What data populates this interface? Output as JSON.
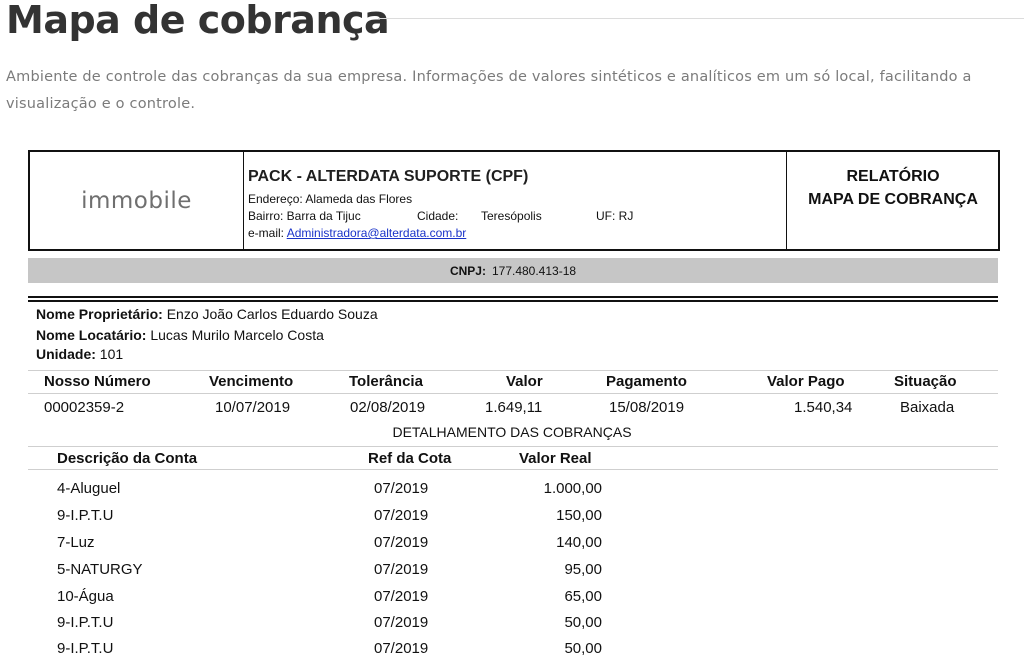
{
  "page": {
    "title": "Mapa de cobrança",
    "description": "Ambiente de controle das cobranças da sua empresa. Informações de valores sintéticos e analíticos em um só local, facilitando a visualização e o controle."
  },
  "report_header": {
    "logo_text": "immobile",
    "company_name": "PACK - ALTERDATA SUPORTE (CPF)",
    "address": "Endereço: Alameda das Flores",
    "bairro": "Bairro: Barra da Tijuc",
    "cidade_label": "Cidade:",
    "cidade": "Teresópolis",
    "uf": "UF: RJ",
    "email_label": "e-mail:",
    "email": "Administradora@alterdata.com.br",
    "report_line1": "RELATÓRIO",
    "report_line2": "MAPA DE COBRANÇA"
  },
  "cnpj": {
    "label": "CNPJ:",
    "value": "177.480.413-18"
  },
  "owner": {
    "proprietario_label": "Nome Proprietário:",
    "proprietario": "Enzo João Carlos Eduardo Souza",
    "locatario_label": "Nome Locatário:",
    "locatario": "Lucas Murilo Marcelo Costa",
    "unidade_label": "Unidade:",
    "unidade": "101"
  },
  "billing": {
    "headers": [
      "Nosso Número",
      "Vencimento",
      "Tolerância",
      "Valor",
      "Pagamento",
      "Valor Pago",
      "Situação"
    ],
    "row": [
      "00002359-2",
      "10/07/2019",
      "02/08/2019",
      "1.649,11",
      "15/08/2019",
      "1.540,34",
      "Baixada"
    ]
  },
  "detail": {
    "title": "DETALHAMENTO DAS COBRANÇAS",
    "headers": [
      "Descrição da Conta",
      "Ref da Cota",
      "Valor Real"
    ],
    "rows": [
      [
        "4-Aluguel",
        "07/2019",
        "1.000,00"
      ],
      [
        "9-I.P.T.U",
        "07/2019",
        "150,00"
      ],
      [
        "7-Luz",
        "07/2019",
        "140,00"
      ],
      [
        "5-NATURGY",
        "07/2019",
        "95,00"
      ],
      [
        "10-Água",
        "07/2019",
        "65,00"
      ],
      [
        "9-I.P.T.U",
        "07/2019",
        "50,00"
      ],
      [
        "9-I.P.T.U",
        "07/2019",
        "50,00"
      ]
    ]
  }
}
